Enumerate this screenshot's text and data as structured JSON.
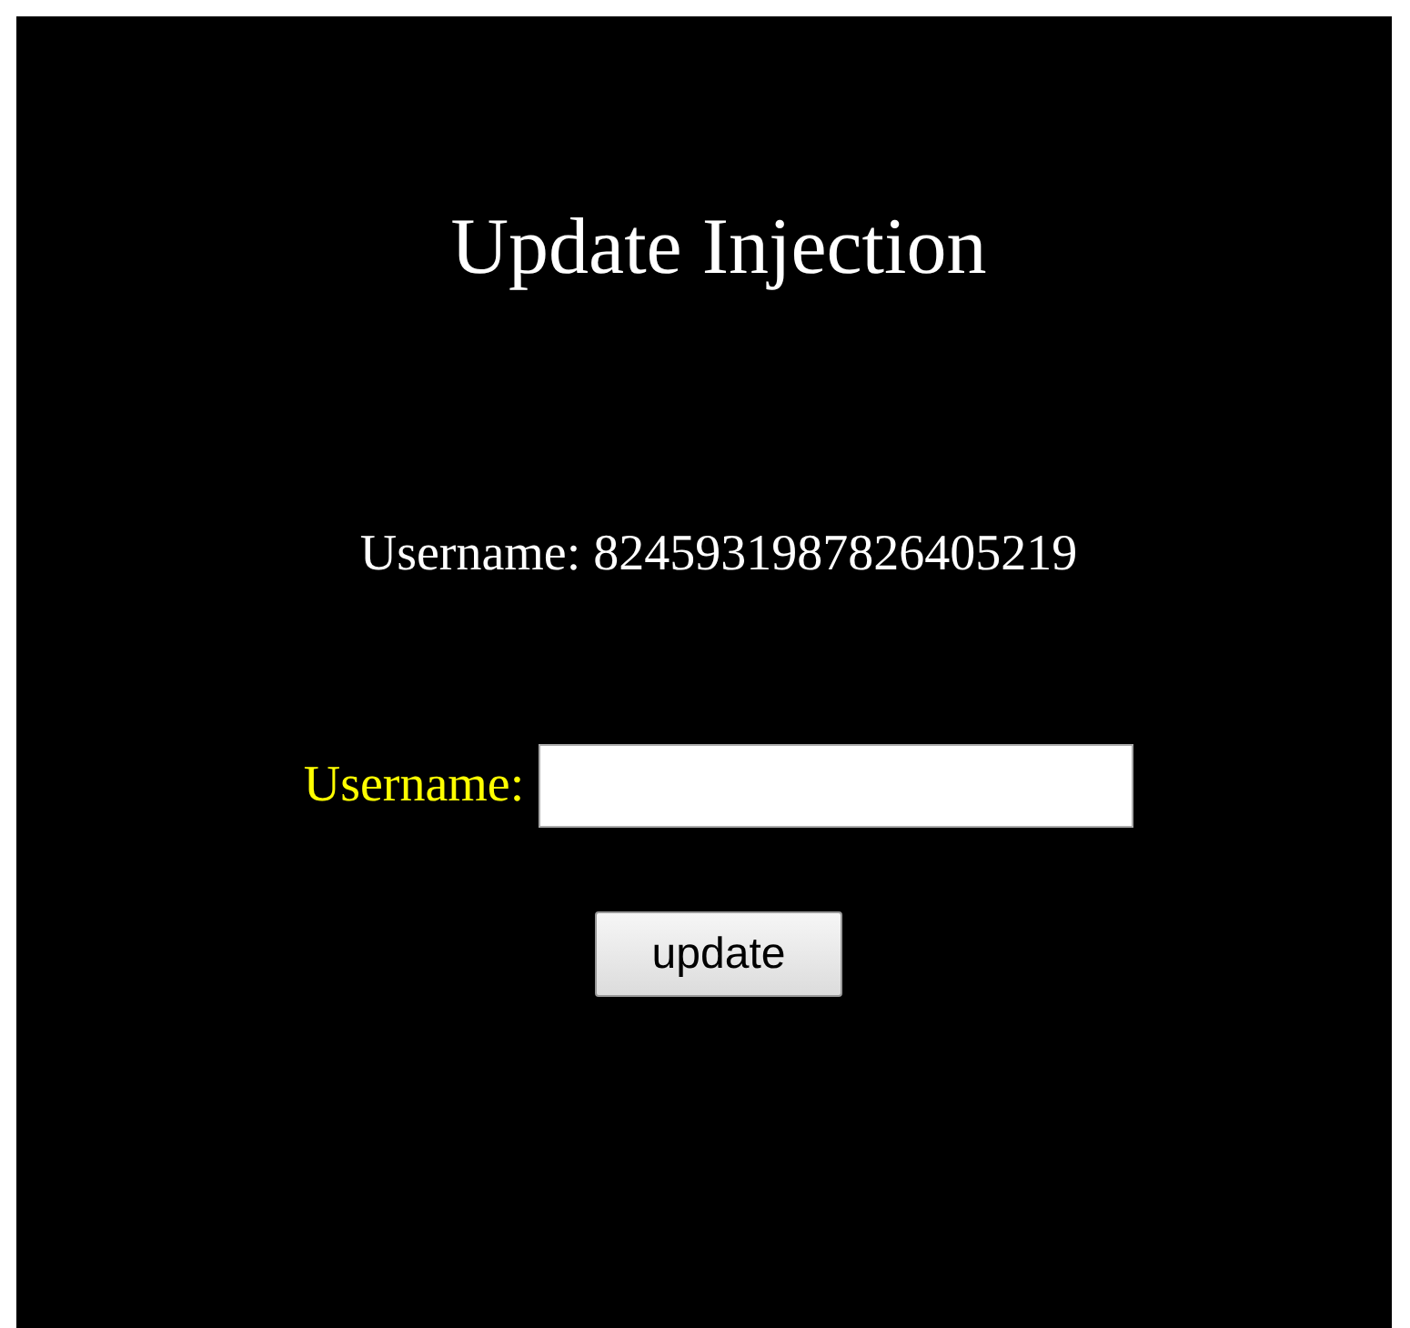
{
  "title": "Update Injection",
  "current_user": {
    "label": "Username:",
    "value": "8245931987826405219"
  },
  "form": {
    "label": "Username:",
    "button": "update"
  }
}
